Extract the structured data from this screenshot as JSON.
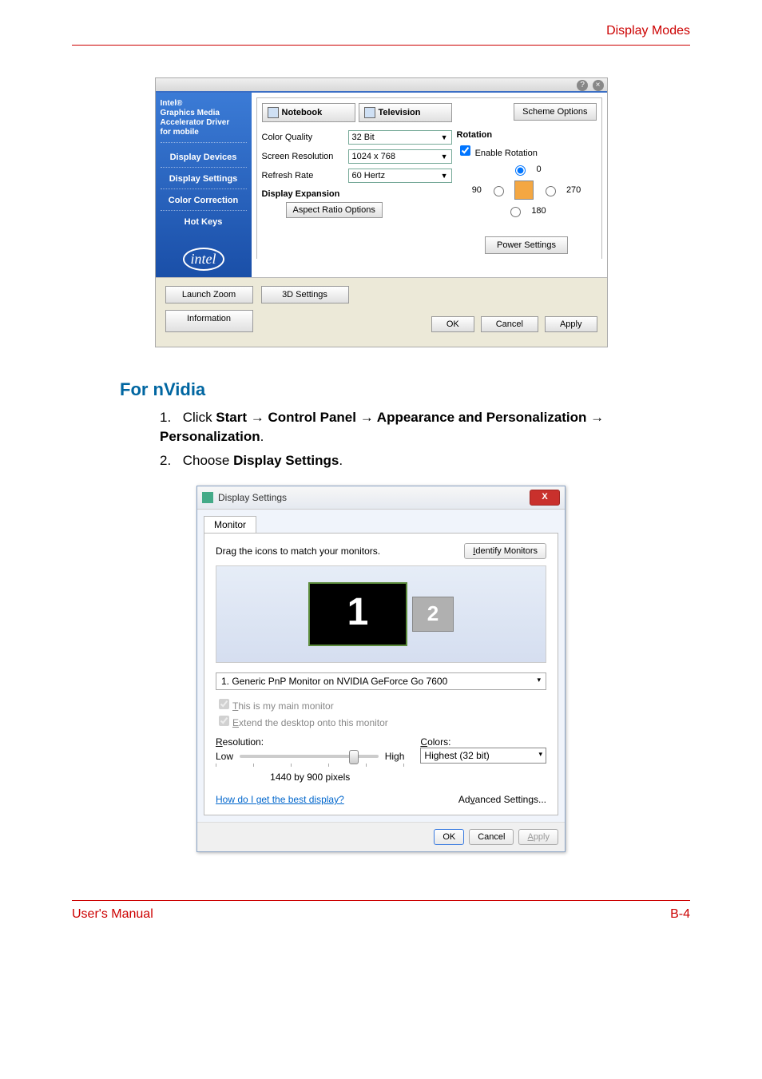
{
  "header": {
    "breadcrumb": "Display Modes"
  },
  "intel": {
    "brand_line1": "Intel®",
    "brand_line2": "Graphics Media",
    "brand_line3": "Accelerator Driver",
    "brand_line4": "for mobile",
    "nav": [
      "Display Devices",
      "Display Settings",
      "Color Correction",
      "Hot Keys"
    ],
    "logo": "intel",
    "tabs": {
      "notebook": "Notebook",
      "television": "Television"
    },
    "scheme_btn": "Scheme Options",
    "fields": {
      "color_quality_label": "Color Quality",
      "color_quality_value": "32 Bit",
      "screen_res_label": "Screen Resolution",
      "screen_res_value": "1024 x 768",
      "refresh_label": "Refresh Rate",
      "refresh_value": "60 Hertz"
    },
    "display_expansion": "Display Expansion",
    "aspect_ratio_btn": "Aspect Ratio Options",
    "rotation": {
      "title": "Rotation",
      "enable": "Enable Rotation",
      "r0": "0",
      "r90": "90",
      "r180": "180",
      "r270": "270"
    },
    "power_btn": "Power Settings",
    "lower": {
      "launch_zoom": "Launch Zoom",
      "threed": "3D Settings",
      "info": "Information",
      "ok": "OK",
      "cancel": "Cancel",
      "apply": "Apply"
    }
  },
  "section": {
    "heading": "For nVidia",
    "step1_num": "1.",
    "step1a": "Click ",
    "step1b": "Start → Control Panel → Appearance and Personalization → Personalization",
    "step1c": ".",
    "step2_num": "2.",
    "step2a": "Choose ",
    "step2b": "Display Settings",
    "step2c": "."
  },
  "ds": {
    "title": "Display Settings",
    "tab": "Monitor",
    "drag_text": "Drag the icons to match your monitors.",
    "identify_btn": "Identify Monitors",
    "mon1": "1",
    "mon2": "2",
    "monitor_dd": "1. Generic PnP Monitor on NVIDIA GeForce Go 7600",
    "chk_main": "This is my main monitor",
    "chk_extend": "Extend the desktop onto this monitor",
    "res_label": "Resolution:",
    "low": "Low",
    "high": "High",
    "res_value": "1440 by 900 pixels",
    "colors_label": "Colors:",
    "colors_value": "Highest (32 bit)",
    "help_link": "How do I get the best display?",
    "advanced": "Advanced Settings...",
    "ok": "OK",
    "cancel": "Cancel",
    "apply": "Apply"
  },
  "footer": {
    "manual": "User's Manual",
    "page": "B-4"
  }
}
